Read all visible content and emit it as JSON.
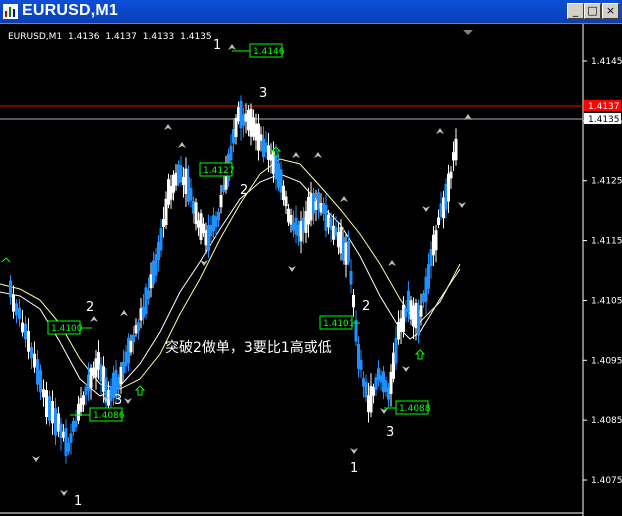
{
  "window": {
    "title": "EURUSD,M1"
  },
  "controls": {
    "minimize": "_",
    "maximize": "□",
    "close": "×"
  },
  "chart": {
    "symbol": "EURUSD,M1",
    "ohlc": [
      "1.4136",
      "1.4137",
      "1.4133",
      "1.4135"
    ],
    "price_labels": [
      "1.4145",
      "1.4135",
      "1.4125",
      "1.4115",
      "1.4105",
      "1.4095",
      "1.4085",
      "1.4075"
    ],
    "ask_price": "1.4137",
    "bid_price": "1.4135",
    "colors": {
      "bull": "#1e90ff",
      "bear": "#ffffff",
      "ask_line": "#ff0000",
      "bid_line": "#a0b4c8",
      "ma_fast": "#ffffff",
      "ma_slow": "#ffff99",
      "label_box": "#00ff00"
    },
    "level_labels": [
      "1.4146",
      "1.4127",
      "1.4100",
      "1.4086",
      "1.4101",
      "1.4088"
    ],
    "wave_labels": [
      "1",
      "3",
      "2",
      "2",
      "3",
      "1",
      "2",
      "1",
      "3"
    ],
    "annotation": "突破2做单，3要比1高或低"
  }
}
